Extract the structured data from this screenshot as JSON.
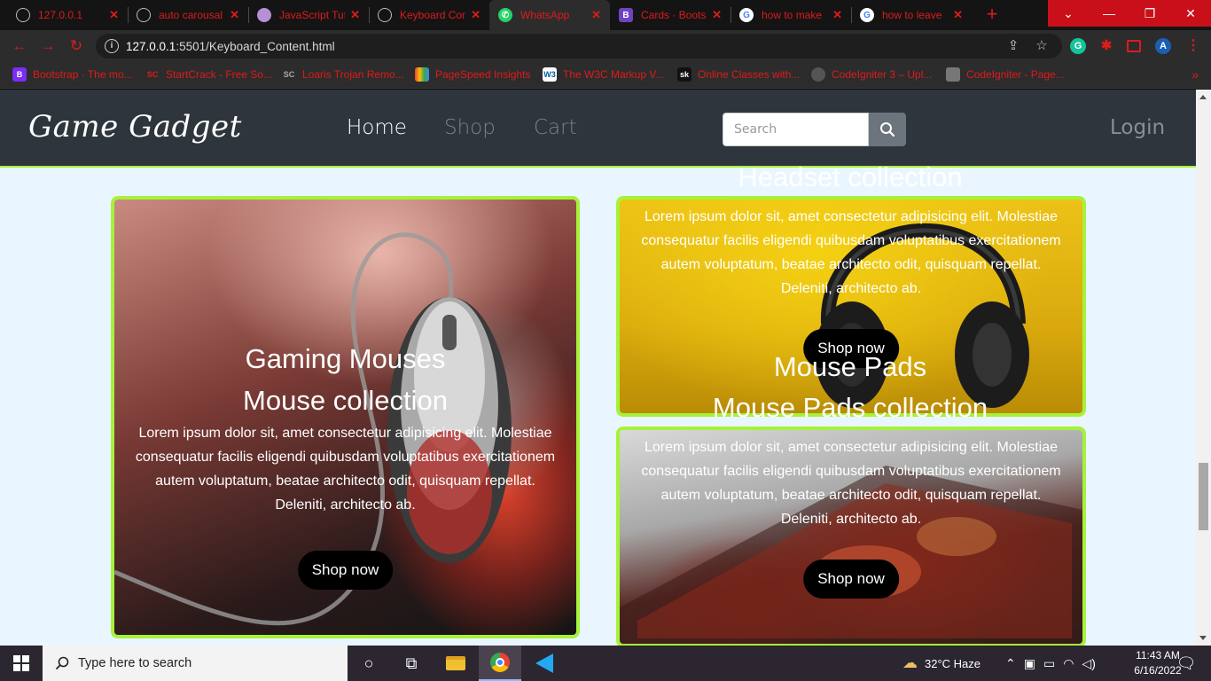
{
  "browser": {
    "tabs": [
      {
        "title": "127.0.0.1",
        "icon": "globe-icon"
      },
      {
        "title": "auto carousal",
        "icon": "globe-icon"
      },
      {
        "title": "JavaScript Tut",
        "icon": "avatar-icon"
      },
      {
        "title": "Keyboard Con",
        "icon": "globe-icon"
      },
      {
        "title": "WhatsApp",
        "icon": "whatsapp-icon"
      },
      {
        "title": "Cards · Boots",
        "icon": "bootstrap-icon"
      },
      {
        "title": "how to make",
        "icon": "google-icon"
      },
      {
        "title": "how to leave",
        "icon": "google-icon"
      }
    ],
    "url_host": "127.0.0.1",
    "url_path": ":5501/Keyboard_Content.html",
    "profile_initial": "A",
    "bookmarks": [
      {
        "label": "Bootstrap · The mo...",
        "icon": "B",
        "color": "#7b2cf5"
      },
      {
        "label": "StartCrack - Free So...",
        "icon": "SC",
        "color": "#2c2c2c"
      },
      {
        "label": "Loaris Trojan Remo...",
        "icon": "SC",
        "color": "#2c2c2c"
      },
      {
        "label": "PageSpeed Insights",
        "icon": "PS",
        "color": "#1a73e8"
      },
      {
        "label": "The W3C Markup V...",
        "icon": "W3",
        "color": "#ffffff"
      },
      {
        "label": "Online Classes with...",
        "icon": "sk",
        "color": "#111111"
      },
      {
        "label": "CodeIgniter 3 – Upl...",
        "icon": "CI",
        "color": "#444444"
      },
      {
        "label": "CodeIgniter - Page...",
        "icon": "CI",
        "color": "#666666"
      }
    ],
    "accent": "#e01a1a"
  },
  "site": {
    "brand": "Game Gadget",
    "nav": [
      {
        "label": "Home",
        "active": true
      },
      {
        "label": "Shop",
        "active": false
      },
      {
        "label": "Cart",
        "active": false
      }
    ],
    "search_placeholder": "Search",
    "login": "Login",
    "accent_border": "#a6f23a"
  },
  "cards": {
    "mouse": {
      "heading": "Gaming Mouses",
      "subheading": "Mouse collection",
      "body": "Lorem ipsum dolor sit, amet consectetur adipisicing elit. Molestiae consequatur facilis eligendi quibusdam voluptatibus exercitationem autem voluptatum, beatae architecto odit, quisquam repellat. Deleniti, architecto ab.",
      "button": "Shop now"
    },
    "headset": {
      "heading": "Headset collection",
      "body": "Lorem ipsum dolor sit, amet consectetur adipisicing elit. Molestiae consequatur facilis eligendi quibusdam voluptatibus exercitationem autem voluptatum, beatae architecto odit, quisquam repellat. Deleniti, architecto ab.",
      "button": "Shop now"
    },
    "pads": {
      "heading": "Mouse Pads",
      "subheading": "Mouse Pads collection",
      "body": "Lorem ipsum dolor sit, amet consectetur adipisicing elit. Molestiae consequatur facilis eligendi quibusdam voluptatibus exercitationem autem voluptatum, beatae architecto odit, quisquam repellat. Deleniti, architecto ab.",
      "button": "Shop now"
    }
  },
  "taskbar": {
    "search_placeholder": "Type here to search",
    "weather": "32°C  Haze",
    "time": "11:43 AM",
    "date": "6/16/2022"
  }
}
